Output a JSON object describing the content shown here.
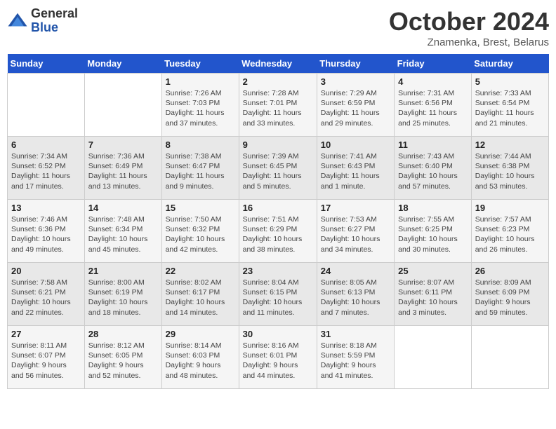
{
  "logo": {
    "general": "General",
    "blue": "Blue"
  },
  "title": "October 2024",
  "location": "Znamenka, Brest, Belarus",
  "days_of_week": [
    "Sunday",
    "Monday",
    "Tuesday",
    "Wednesday",
    "Thursday",
    "Friday",
    "Saturday"
  ],
  "weeks": [
    [
      {
        "num": "",
        "detail": ""
      },
      {
        "num": "",
        "detail": ""
      },
      {
        "num": "1",
        "detail": "Sunrise: 7:26 AM\nSunset: 7:03 PM\nDaylight: 11 hours\nand 37 minutes."
      },
      {
        "num": "2",
        "detail": "Sunrise: 7:28 AM\nSunset: 7:01 PM\nDaylight: 11 hours\nand 33 minutes."
      },
      {
        "num": "3",
        "detail": "Sunrise: 7:29 AM\nSunset: 6:59 PM\nDaylight: 11 hours\nand 29 minutes."
      },
      {
        "num": "4",
        "detail": "Sunrise: 7:31 AM\nSunset: 6:56 PM\nDaylight: 11 hours\nand 25 minutes."
      },
      {
        "num": "5",
        "detail": "Sunrise: 7:33 AM\nSunset: 6:54 PM\nDaylight: 11 hours\nand 21 minutes."
      }
    ],
    [
      {
        "num": "6",
        "detail": "Sunrise: 7:34 AM\nSunset: 6:52 PM\nDaylight: 11 hours\nand 17 minutes."
      },
      {
        "num": "7",
        "detail": "Sunrise: 7:36 AM\nSunset: 6:49 PM\nDaylight: 11 hours\nand 13 minutes."
      },
      {
        "num": "8",
        "detail": "Sunrise: 7:38 AM\nSunset: 6:47 PM\nDaylight: 11 hours\nand 9 minutes."
      },
      {
        "num": "9",
        "detail": "Sunrise: 7:39 AM\nSunset: 6:45 PM\nDaylight: 11 hours\nand 5 minutes."
      },
      {
        "num": "10",
        "detail": "Sunrise: 7:41 AM\nSunset: 6:43 PM\nDaylight: 11 hours\nand 1 minute."
      },
      {
        "num": "11",
        "detail": "Sunrise: 7:43 AM\nSunset: 6:40 PM\nDaylight: 10 hours\nand 57 minutes."
      },
      {
        "num": "12",
        "detail": "Sunrise: 7:44 AM\nSunset: 6:38 PM\nDaylight: 10 hours\nand 53 minutes."
      }
    ],
    [
      {
        "num": "13",
        "detail": "Sunrise: 7:46 AM\nSunset: 6:36 PM\nDaylight: 10 hours\nand 49 minutes."
      },
      {
        "num": "14",
        "detail": "Sunrise: 7:48 AM\nSunset: 6:34 PM\nDaylight: 10 hours\nand 45 minutes."
      },
      {
        "num": "15",
        "detail": "Sunrise: 7:50 AM\nSunset: 6:32 PM\nDaylight: 10 hours\nand 42 minutes."
      },
      {
        "num": "16",
        "detail": "Sunrise: 7:51 AM\nSunset: 6:29 PM\nDaylight: 10 hours\nand 38 minutes."
      },
      {
        "num": "17",
        "detail": "Sunrise: 7:53 AM\nSunset: 6:27 PM\nDaylight: 10 hours\nand 34 minutes."
      },
      {
        "num": "18",
        "detail": "Sunrise: 7:55 AM\nSunset: 6:25 PM\nDaylight: 10 hours\nand 30 minutes."
      },
      {
        "num": "19",
        "detail": "Sunrise: 7:57 AM\nSunset: 6:23 PM\nDaylight: 10 hours\nand 26 minutes."
      }
    ],
    [
      {
        "num": "20",
        "detail": "Sunrise: 7:58 AM\nSunset: 6:21 PM\nDaylight: 10 hours\nand 22 minutes."
      },
      {
        "num": "21",
        "detail": "Sunrise: 8:00 AM\nSunset: 6:19 PM\nDaylight: 10 hours\nand 18 minutes."
      },
      {
        "num": "22",
        "detail": "Sunrise: 8:02 AM\nSunset: 6:17 PM\nDaylight: 10 hours\nand 14 minutes."
      },
      {
        "num": "23",
        "detail": "Sunrise: 8:04 AM\nSunset: 6:15 PM\nDaylight: 10 hours\nand 11 minutes."
      },
      {
        "num": "24",
        "detail": "Sunrise: 8:05 AM\nSunset: 6:13 PM\nDaylight: 10 hours\nand 7 minutes."
      },
      {
        "num": "25",
        "detail": "Sunrise: 8:07 AM\nSunset: 6:11 PM\nDaylight: 10 hours\nand 3 minutes."
      },
      {
        "num": "26",
        "detail": "Sunrise: 8:09 AM\nSunset: 6:09 PM\nDaylight: 9 hours\nand 59 minutes."
      }
    ],
    [
      {
        "num": "27",
        "detail": "Sunrise: 8:11 AM\nSunset: 6:07 PM\nDaylight: 9 hours\nand 56 minutes."
      },
      {
        "num": "28",
        "detail": "Sunrise: 8:12 AM\nSunset: 6:05 PM\nDaylight: 9 hours\nand 52 minutes."
      },
      {
        "num": "29",
        "detail": "Sunrise: 8:14 AM\nSunset: 6:03 PM\nDaylight: 9 hours\nand 48 minutes."
      },
      {
        "num": "30",
        "detail": "Sunrise: 8:16 AM\nSunset: 6:01 PM\nDaylight: 9 hours\nand 44 minutes."
      },
      {
        "num": "31",
        "detail": "Sunrise: 8:18 AM\nSunset: 5:59 PM\nDaylight: 9 hours\nand 41 minutes."
      },
      {
        "num": "",
        "detail": ""
      },
      {
        "num": "",
        "detail": ""
      }
    ]
  ]
}
